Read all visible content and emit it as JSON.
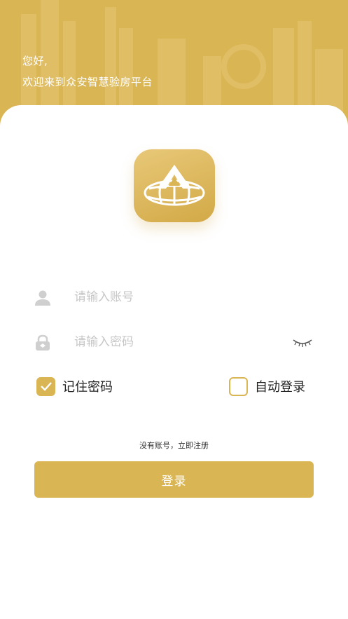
{
  "header": {
    "greeting_line1": "您好,",
    "greeting_line2": "欢迎来到众安智慧验房平台"
  },
  "login_form": {
    "account_placeholder": "请输入账号",
    "password_placeholder": "请输入密码",
    "remember_password": {
      "label": "记住密码",
      "checked": true
    },
    "auto_login": {
      "label": "自动登录",
      "checked": false
    },
    "register_link": "没有账号，立即注册",
    "login_button": "登录"
  },
  "icons": {
    "account": "user-icon",
    "password": "lock-icon",
    "toggle_password": "eye-closed-icon",
    "logo": "app-logo"
  },
  "colors": {
    "brand": "#d9b554",
    "placeholder": "#c7c7c7",
    "text": "#222222"
  }
}
